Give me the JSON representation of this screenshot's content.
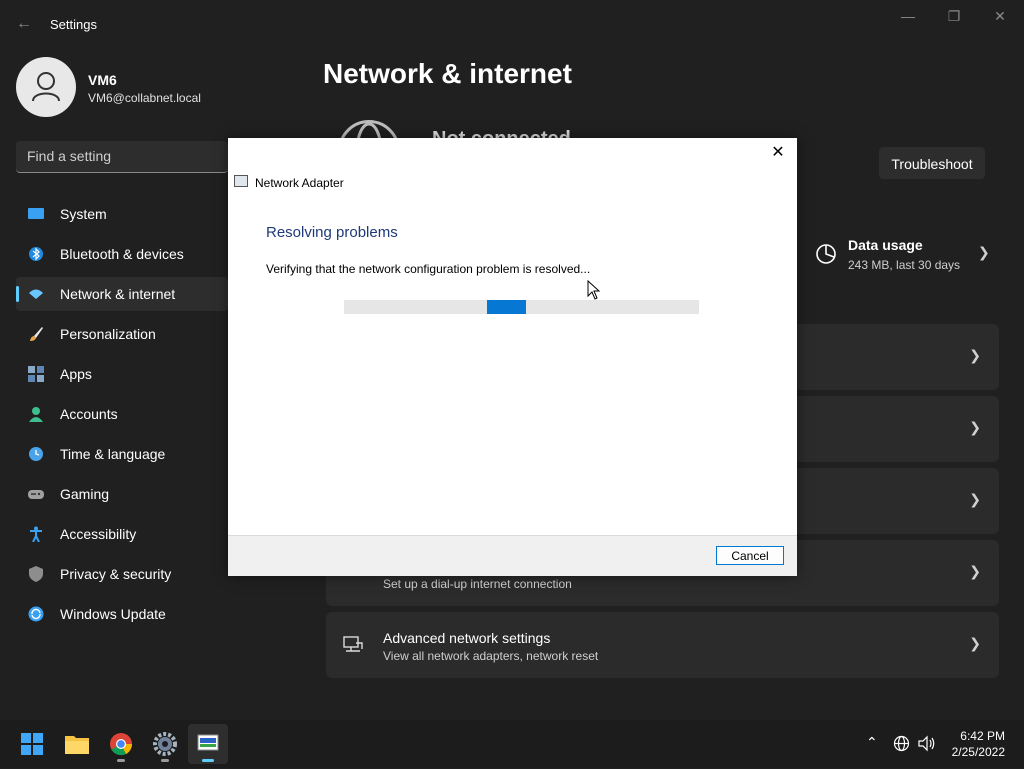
{
  "window": {
    "title": "Settings",
    "minimize": "—",
    "restore": "❐",
    "close": "✕"
  },
  "profile": {
    "name": "VM6",
    "email": "VM6@collabnet.local"
  },
  "search": {
    "placeholder": "Find a setting"
  },
  "sidebar": {
    "items": [
      {
        "label": "System",
        "icon": "system-icon",
        "color": "#3aa0f2"
      },
      {
        "label": "Bluetooth & devices",
        "icon": "bluetooth-icon",
        "color": "#1f8ae0"
      },
      {
        "label": "Network & internet",
        "icon": "wifi-icon",
        "color": "#6ac6ff",
        "selected": true
      },
      {
        "label": "Personalization",
        "icon": "brush-icon",
        "color": "#e8a54b"
      },
      {
        "label": "Apps",
        "icon": "apps-icon",
        "color": "#8aa8c8"
      },
      {
        "label": "Accounts",
        "icon": "account-icon",
        "color": "#3fbf8f"
      },
      {
        "label": "Time & language",
        "icon": "clock-globe-icon",
        "color": "#4aa3e8"
      },
      {
        "label": "Gaming",
        "icon": "gamepad-icon",
        "color": "#a0a0a0"
      },
      {
        "label": "Accessibility",
        "icon": "accessibility-icon",
        "color": "#3aa0f2"
      },
      {
        "label": "Privacy & security",
        "icon": "shield-icon",
        "color": "#8d8d8d"
      },
      {
        "label": "Windows Update",
        "icon": "update-icon",
        "color": "#3aa0f2"
      }
    ]
  },
  "main": {
    "title": "Network & internet",
    "status_partial": "Not connected",
    "troubleshoot_label": "Troubleshoot",
    "data_usage": {
      "title": "Data usage",
      "subtitle": "243 MB, last 30 days"
    },
    "cards": [
      {
        "title": "",
        "subtitle": ""
      },
      {
        "title": "",
        "subtitle": ""
      },
      {
        "title": "",
        "subtitle": ""
      },
      {
        "title": "",
        "subtitle": "Set up a dial-up internet connection",
        "icon": "dialup-icon"
      },
      {
        "title": "Advanced network settings",
        "subtitle": "View all network adapters, network reset",
        "icon": "network-adapter-icon"
      }
    ]
  },
  "dialog": {
    "title": "Network Adapter",
    "heading": "Resolving problems",
    "status": "Verifying that the network configuration problem is resolved...",
    "close": "✕",
    "cancel_label": "Cancel",
    "progress_style": "indeterminate",
    "accent": "#0678d4"
  },
  "taskbar": {
    "apps": [
      "start-icon",
      "file-explorer-icon",
      "chrome-icon",
      "settings-icon",
      "network-adapter-icon"
    ],
    "time": "6:42 PM",
    "date": "2/25/2022"
  }
}
